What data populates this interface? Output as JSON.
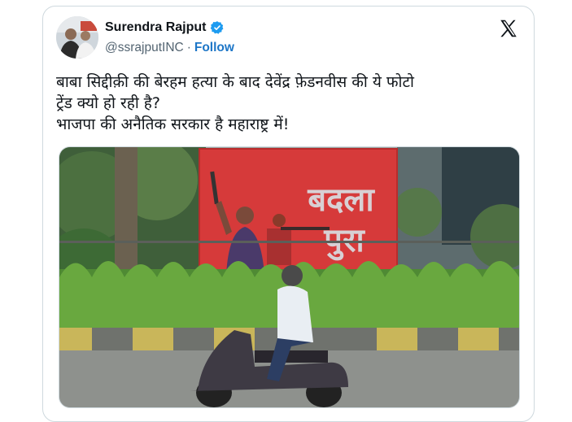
{
  "author": {
    "name": "Surendra Rajput",
    "handle": "@ssrajputINC",
    "separator": "·",
    "follow_label": "Follow"
  },
  "tweet": {
    "lines": [
      "बाबा सिद्दीक़ी की बेरहम हत्या के बाद देवेंद्र फ़ेडनवीस की ये फोटो",
      "ट्रेंड क्यो हो रही है?",
      "भाजपा की अनैतिक सरकार है महाराष्ट्र में!"
    ]
  },
  "media": {
    "billboard_text": [
      "बदला",
      "पुरा"
    ]
  },
  "icons": {
    "verified": "verified-badge-icon",
    "platform": "x-logo-icon"
  },
  "colors": {
    "follow": "#1d76c7",
    "verified": "#1d9bf0",
    "billboard": "#d63a3a"
  }
}
